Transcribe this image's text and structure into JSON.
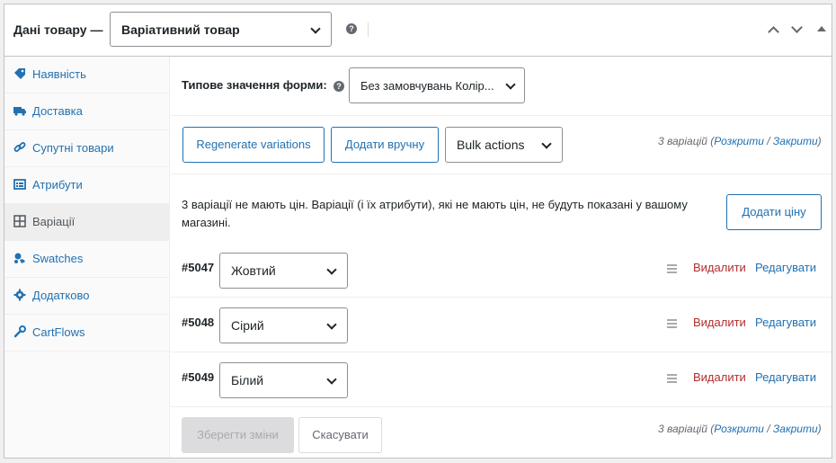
{
  "header": {
    "title": "Дані товару —",
    "product_type": "Варіативний товар",
    "help_glyph": "?"
  },
  "sidebar": {
    "items": [
      {
        "label": "Наявність",
        "icon": "tag-icon"
      },
      {
        "label": "Доставка",
        "icon": "truck-icon"
      },
      {
        "label": "Супутні товари",
        "icon": "link-icon"
      },
      {
        "label": "Атрибути",
        "icon": "list-icon"
      },
      {
        "label": "Варіації",
        "icon": "grid-icon",
        "active": true
      },
      {
        "label": "Swatches",
        "icon": "swatches-icon"
      },
      {
        "label": "Додатково",
        "icon": "gear-icon"
      },
      {
        "label": "CartFlows",
        "icon": "wrench-icon"
      }
    ]
  },
  "main": {
    "default_form_label": "Типове значення форми:",
    "default_form_value": "Без замовчувань Колір...",
    "regenerate_label": "Regenerate variations",
    "add_manual_label": "Додати вручну",
    "bulk_actions_label": "Bulk actions",
    "variation_count": {
      "prefix": "3 варіацій (",
      "expand": "Розкрити",
      "separator": " / ",
      "collapse": "Закрити",
      "suffix": ")"
    },
    "notice_text": "3 варіації не мають цін. Варіації (і їх атрибути), які не мають цін, не будуть показані у вашому магазині.",
    "add_price_label": "Додати ціну",
    "variations": [
      {
        "id": "#5047",
        "value": "Жовтий"
      },
      {
        "id": "#5048",
        "value": "Сірий"
      },
      {
        "id": "#5049",
        "value": "Білий"
      }
    ],
    "delete_label": "Видалити",
    "edit_label": "Редагувати",
    "save_label": "Зберегти зміни",
    "cancel_label": "Скасувати"
  },
  "colors": {
    "link": "#2271b1",
    "delete": "#b32d2e",
    "border": "#c3c4c7",
    "active_tab_bg": "#eeeeee"
  }
}
